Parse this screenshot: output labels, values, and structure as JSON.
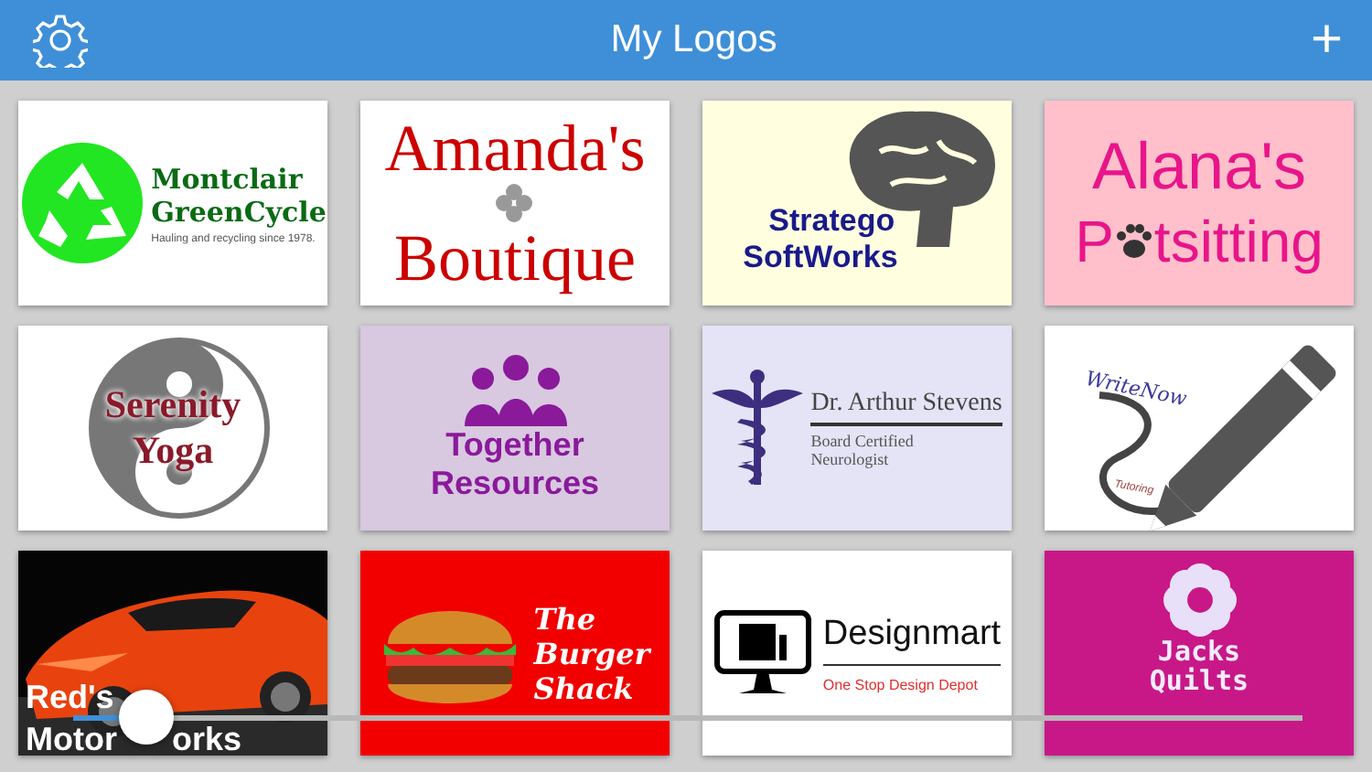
{
  "header": {
    "title": "My Logos",
    "add_label": "+"
  },
  "logos": [
    {
      "kind": "recycle",
      "texts": [
        "Montclair",
        "GreenCycle",
        "Hauling and recycling since 1978."
      ]
    },
    {
      "kind": "boutique",
      "texts": [
        "Amanda's",
        "Boutique"
      ]
    },
    {
      "kind": "brain",
      "texts": [
        "Stratego",
        "SoftWorks"
      ]
    },
    {
      "kind": "paw",
      "texts": [
        "Alana's",
        "P",
        "tsitting"
      ]
    },
    {
      "kind": "yinyang",
      "texts": [
        "Serenity",
        "Yoga"
      ]
    },
    {
      "kind": "people",
      "texts": [
        "Together",
        "Resources"
      ]
    },
    {
      "kind": "caduceus",
      "texts": [
        "Dr. Arthur Stevens",
        "Board Certified",
        "Neurologist"
      ]
    },
    {
      "kind": "pencil",
      "texts": [
        "WriteNow",
        "Tutoring"
      ]
    },
    {
      "kind": "car",
      "texts": [
        "Red's",
        "Motor",
        "orks"
      ]
    },
    {
      "kind": "burger",
      "texts": [
        "The",
        "Burger",
        "Shack"
      ]
    },
    {
      "kind": "monitor",
      "texts": [
        "Designmart",
        "One Stop Design Depot"
      ]
    },
    {
      "kind": "flower",
      "texts": [
        "Jacks",
        "Quilts"
      ]
    }
  ],
  "zoom_slider": {
    "level": 0.06
  }
}
